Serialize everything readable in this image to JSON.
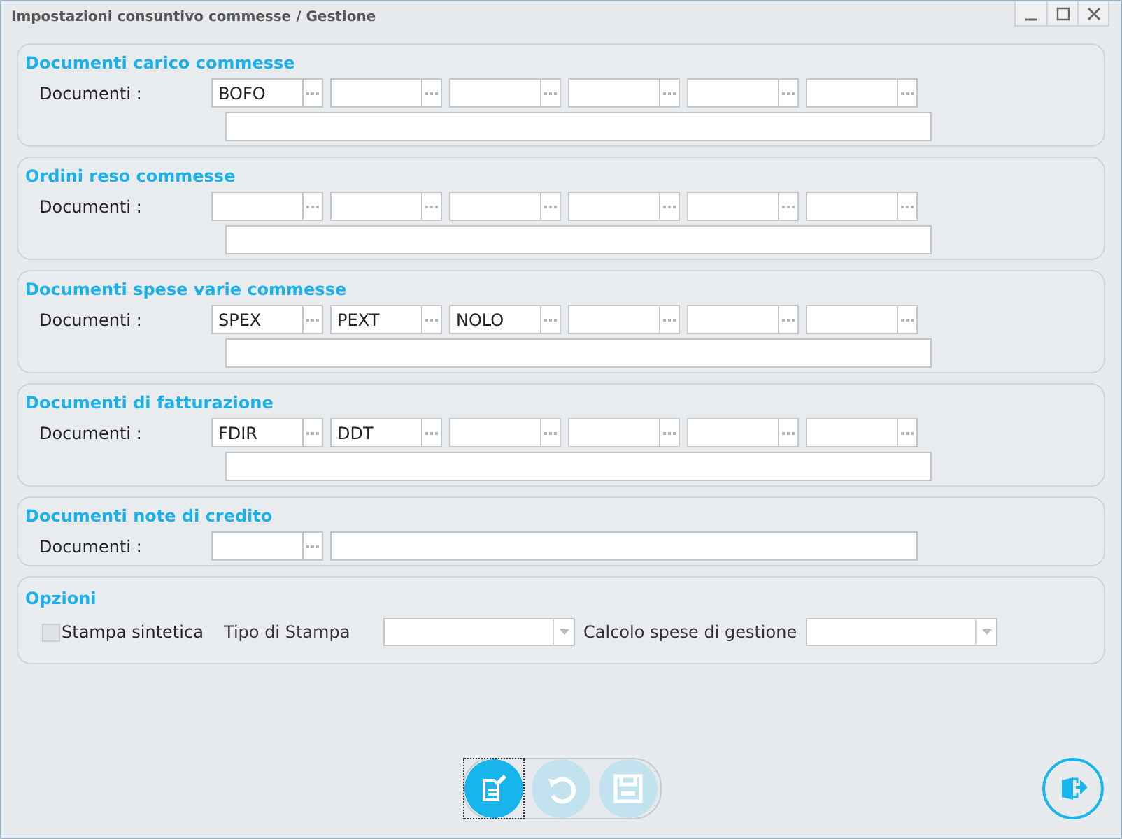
{
  "window": {
    "title": "Impostazioni consuntivo commesse / Gestione"
  },
  "sections": [
    {
      "title": "Documenti carico commesse",
      "kind": "grid",
      "label": "Documenti :",
      "codes": [
        "BOFO"
      ]
    },
    {
      "title": "Ordini reso commesse",
      "kind": "grid",
      "label": "Documenti :"
    },
    {
      "title": "Documenti spese varie commesse",
      "kind": "grid",
      "label": "Documenti :",
      "codes": [
        "SPEX",
        "PEXT",
        "NOLO"
      ]
    },
    {
      "title": "Documenti di fatturazione",
      "kind": "grid",
      "label": "Documenti :",
      "codes": [
        "FDIR",
        "DDT"
      ]
    },
    {
      "title": "Documenti note di credito",
      "kind": "inline",
      "label": "Documenti :"
    }
  ],
  "options": {
    "title": "Opzioni",
    "checkbox": {
      "label": "Stampa sintetica",
      "checked": false
    },
    "dropdowns": [
      {
        "label": "Tipo di Stampa"
      },
      {
        "label": "Calcolo spese di gestione"
      }
    ]
  },
  "toolbar": {
    "buttons": [
      {
        "kind": "edit",
        "disabled": false,
        "focused": true
      },
      {
        "kind": "undo",
        "disabled": true,
        "focused": false
      },
      {
        "kind": "save",
        "disabled": true,
        "focused": false
      }
    ]
  }
}
